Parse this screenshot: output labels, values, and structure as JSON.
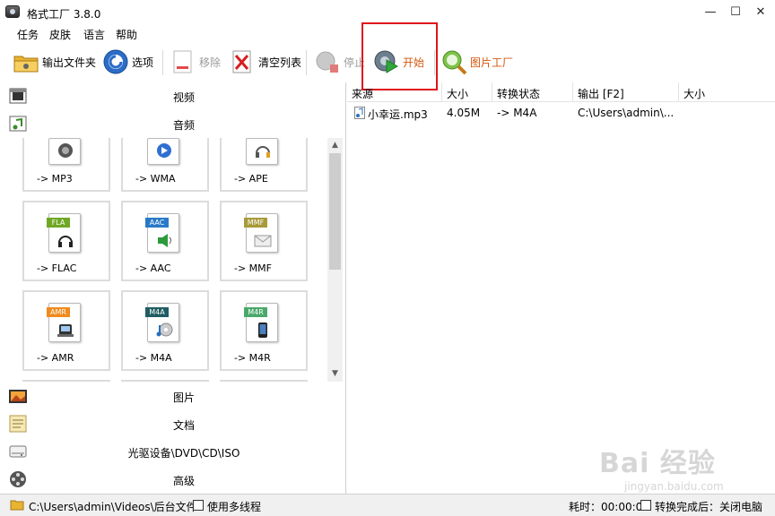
{
  "window": {
    "title": "格式工厂 3.8.0",
    "minimize": "—",
    "maximize": "☐",
    "close": "✕"
  },
  "menu": [
    "任务",
    "皮肤",
    "语言",
    "帮助"
  ],
  "toolbar": {
    "output_folder": "输出文件夹",
    "options": "选项",
    "remove": "移除",
    "clear_list": "清空列表",
    "stop": "停止",
    "start": "开始",
    "picture_factory": "图片工厂"
  },
  "categories": {
    "video": "视频",
    "audio": "音频",
    "picture": "图片",
    "document": "文档",
    "optical": "光驱设备\\DVD\\CD\\ISO",
    "advanced": "高级"
  },
  "formats": [
    {
      "label": "-> MP3",
      "tag": "",
      "color": "#4a4a4a"
    },
    {
      "label": "-> WMA",
      "tag": "",
      "color": "#2f6fd0"
    },
    {
      "label": "-> APE",
      "tag": "",
      "color": "#6b6b6b"
    },
    {
      "label": "-> FLAC",
      "tag": "FLA",
      "color": "#6fa825"
    },
    {
      "label": "-> AAC",
      "tag": "AAC",
      "color": "#2a79c8"
    },
    {
      "label": "-> MMF",
      "tag": "MMF",
      "color": "#a89a3a"
    },
    {
      "label": "-> AMR",
      "tag": "AMR",
      "color": "#f08a1c"
    },
    {
      "label": "-> M4A",
      "tag": "M4A",
      "color": "#1f5d63"
    },
    {
      "label": "-> M4R",
      "tag": "M4R",
      "color": "#4aa86a"
    }
  ],
  "scroll": {
    "up": "▲",
    "down": "▼"
  },
  "task_table": {
    "headers": [
      "来源",
      "大小",
      "转换状态",
      "输出 [F2]",
      "大小"
    ],
    "rows": [
      {
        "source": "小幸运.mp3",
        "size": "4.05M",
        "status": "-> M4A",
        "output": "C:\\Users\\admin\\...",
        "out_size": ""
      }
    ]
  },
  "status": {
    "path": "C:\\Users\\admin\\Videos\\后台文件",
    "multithread": "使用多线程",
    "elapsed": "耗时：00:00:00",
    "after_convert": "转换完成后：关闭电脑"
  },
  "watermark": {
    "main": "Bai 经验",
    "sub": "jingyan.baidu.com"
  },
  "colors": {
    "highlight": "#e0141a",
    "start_label": "#d4580c"
  }
}
